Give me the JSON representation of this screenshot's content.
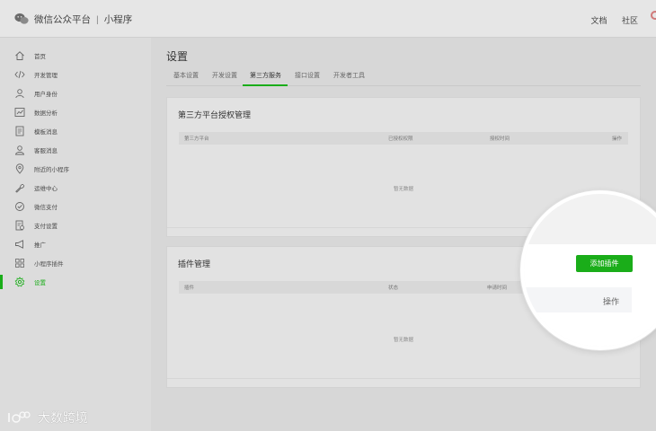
{
  "header": {
    "platform": "微信公众平台",
    "product": "小程序",
    "separator": "|",
    "links": [
      "文档",
      "社区"
    ]
  },
  "sidebar": {
    "items": [
      {
        "label": "首页",
        "icon": "home-icon"
      },
      {
        "label": "开发管理",
        "icon": "code-icon"
      },
      {
        "label": "用户身份",
        "icon": "user-icon"
      },
      {
        "label": "数据分析",
        "icon": "chart-icon"
      },
      {
        "label": "模板消息",
        "icon": "document-icon"
      },
      {
        "label": "客服消息",
        "icon": "customer-service-icon"
      },
      {
        "label": "附近的小程序",
        "icon": "location-icon"
      },
      {
        "label": "运维中心",
        "icon": "wrench-icon"
      },
      {
        "label": "微信支付",
        "icon": "payment-icon"
      },
      {
        "label": "支付设置",
        "icon": "payment-settings-icon"
      },
      {
        "label": "推广",
        "icon": "megaphone-icon"
      },
      {
        "label": "小程序插件",
        "icon": "plugin-grid-icon"
      },
      {
        "label": "设置",
        "icon": "gear-icon",
        "active": true
      }
    ]
  },
  "main": {
    "title": "设置",
    "tabs": [
      {
        "label": "基本设置"
      },
      {
        "label": "开发设置"
      },
      {
        "label": "第三方服务",
        "active": true
      },
      {
        "label": "接口设置"
      },
      {
        "label": "开发者工具"
      }
    ],
    "third_party": {
      "title": "第三方平台授权管理",
      "columns": [
        "第三方平台",
        "已授权权限",
        "授权时间",
        "操作"
      ],
      "empty_text": "暂无数据"
    },
    "plugins": {
      "title": "插件管理",
      "columns": [
        "插件",
        "状态",
        "申请时间"
      ],
      "empty_text": "暂无数据",
      "add_button": "添加插件",
      "operation_column": "操作"
    }
  },
  "watermark": {
    "text": "大数跨境"
  },
  "colors": {
    "accent": "#1aad19"
  }
}
